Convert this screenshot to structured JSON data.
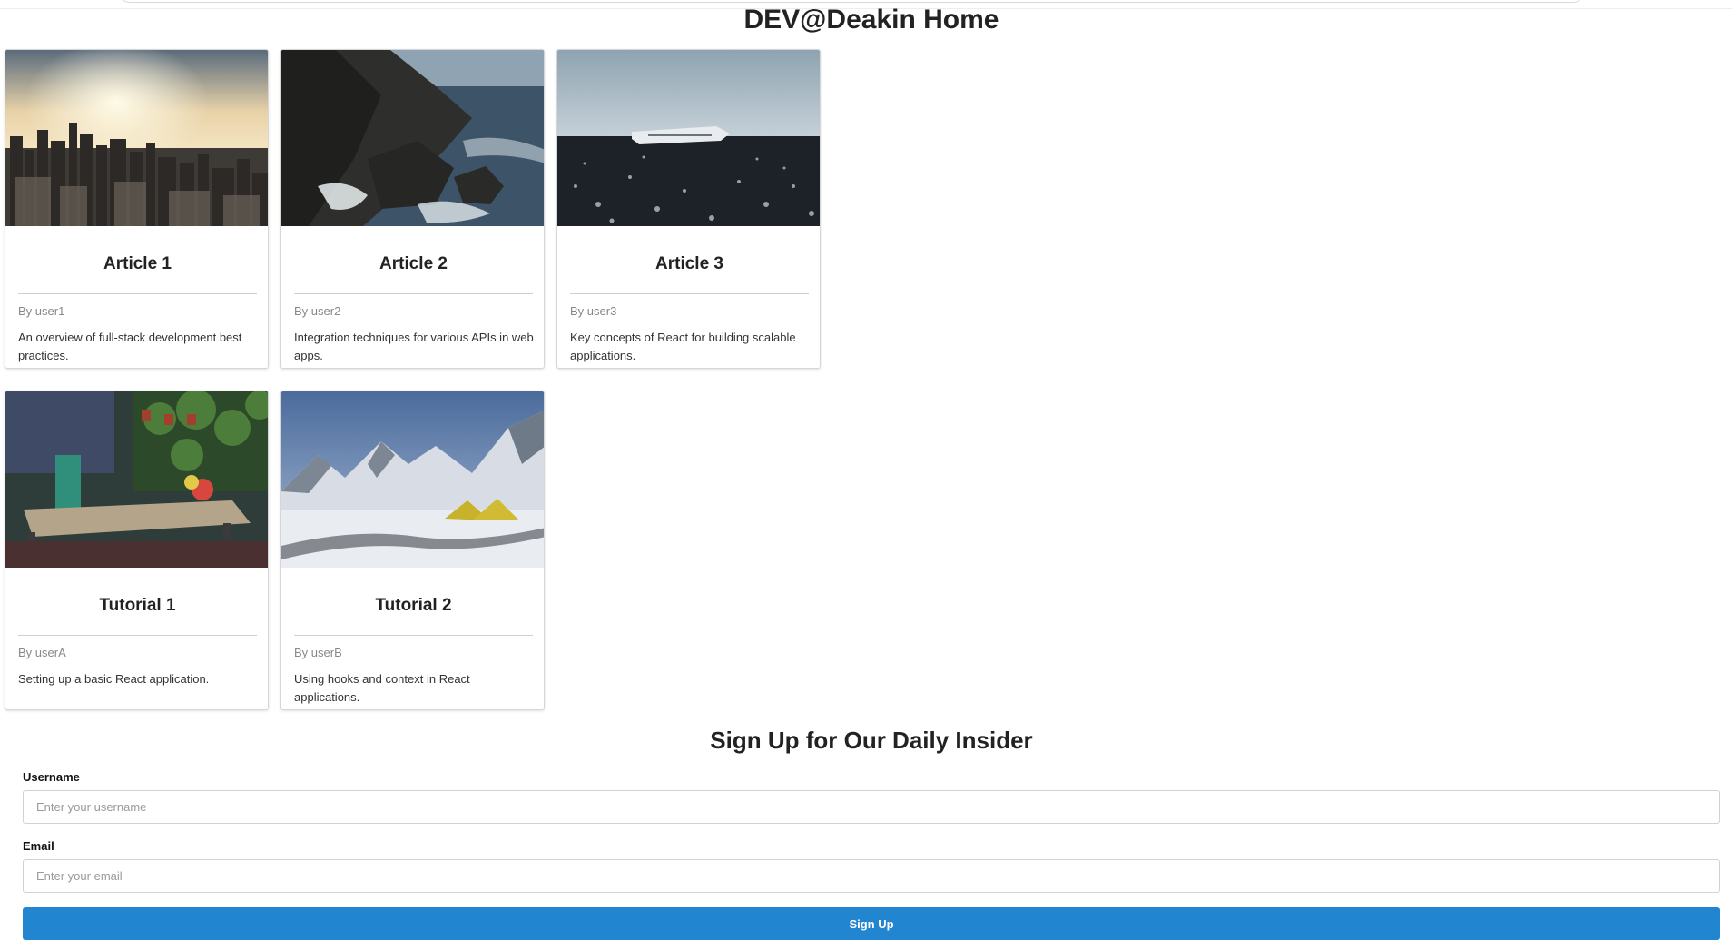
{
  "page": {
    "title": "DEV@Deakin Home"
  },
  "articles": [
    {
      "title": "Article 1",
      "author": "By user1",
      "description": "An overview of full-stack development best practices."
    },
    {
      "title": "Article 2",
      "author": "By user2",
      "description": "Integration techniques for various APIs in web apps."
    },
    {
      "title": "Article 3",
      "author": "By user3",
      "description": "Key concepts of React for building scalable applications."
    }
  ],
  "tutorials": [
    {
      "title": "Tutorial 1",
      "author": "By userA",
      "description": "Setting up a basic React application."
    },
    {
      "title": "Tutorial 2",
      "author": "By userB",
      "description": "Using hooks and context in React applications."
    }
  ],
  "signup": {
    "title": "Sign Up for Our Daily Insider",
    "username_label": "Username",
    "username_placeholder": "Enter your username",
    "email_label": "Email",
    "email_placeholder": "Enter your email",
    "button_label": "Sign Up"
  },
  "colors": {
    "primary_button": "#2185d0"
  }
}
